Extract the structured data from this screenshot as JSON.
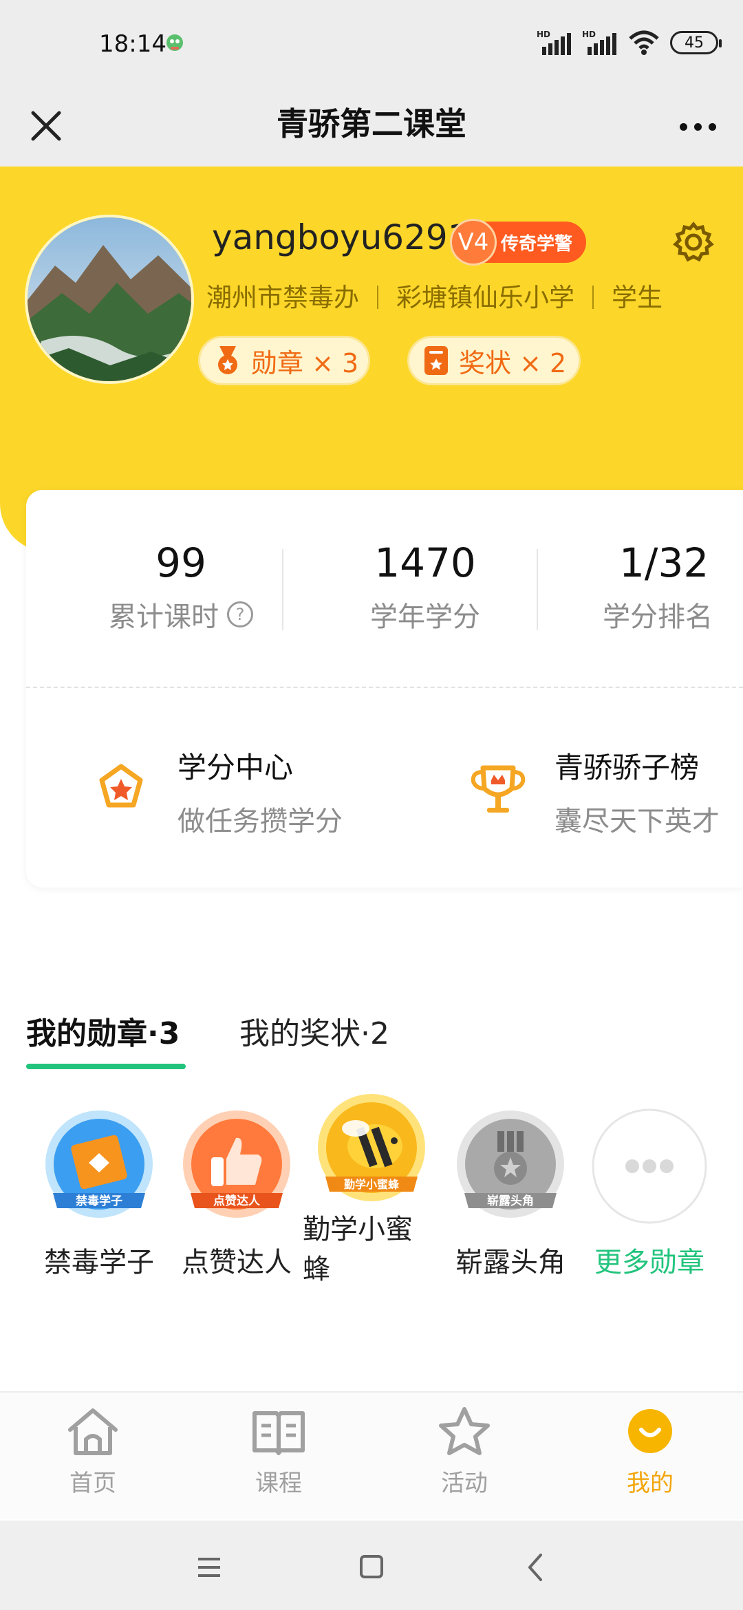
{
  "status_bar": {
    "time": "18:14",
    "battery": "45",
    "network_labels": [
      "HD",
      "HD"
    ]
  },
  "header": {
    "title": "青骄第二课堂"
  },
  "profile": {
    "username": "yangboyu6291",
    "level": "V4",
    "level_title": "传奇学警",
    "org": [
      "潮州市禁毒办",
      "彩塘镇仙乐小学",
      "学生"
    ],
    "medal_pill": "勋章 × 3",
    "award_pill": "奖状 × 2"
  },
  "stats": [
    {
      "value": "99",
      "label": "累计课时"
    },
    {
      "value": "1470",
      "label": "学年学分"
    },
    {
      "value": "1/32",
      "label": "学分排名"
    }
  ],
  "help_symbol": "?",
  "entries": [
    {
      "title": "学分中心",
      "subtitle": "做任务攒学分",
      "icon": "star-badge-icon"
    },
    {
      "title": "青骄骄子榜",
      "subtitle": "囊尽天下英才",
      "icon": "trophy-icon"
    }
  ],
  "tabs": {
    "active": "我的勋章·3",
    "inactive": "我的奖状·2"
  },
  "badges": [
    {
      "name": "禁毒学子",
      "ribbon": "禁毒学子"
    },
    {
      "name": "点赞达人",
      "ribbon": "点赞达人"
    },
    {
      "name": "勤学小蜜蜂",
      "name_line1": "勤学小蜜",
      "name_line2": "蜂",
      "ribbon": "勤学小蜜蜂"
    },
    {
      "name": "崭露头角",
      "ribbon": "崭露头角"
    },
    {
      "name": "更多勋章"
    }
  ],
  "bottom_nav": [
    {
      "label": "首页",
      "icon": "home-icon"
    },
    {
      "label": "课程",
      "icon": "book-icon"
    },
    {
      "label": "活动",
      "icon": "star-icon"
    },
    {
      "label": "我的",
      "icon": "smile-icon",
      "active": true
    }
  ],
  "colors": {
    "yellow": "#fcd72a",
    "green": "#22c47d",
    "orange": "#f06a14",
    "nav_active": "#f3a60d"
  }
}
